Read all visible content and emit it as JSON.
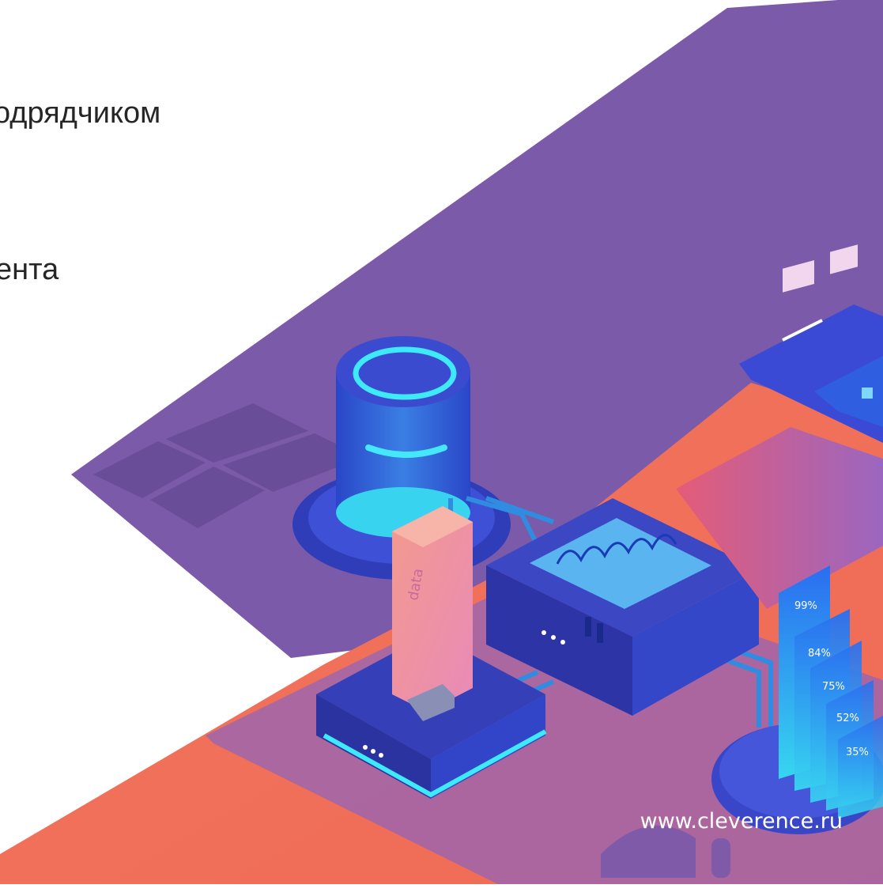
{
  "slide": {
    "lines": [
      "одрядчиком",
      "ента"
    ],
    "footer_url": "www.cleverence.ru"
  },
  "illustration": {
    "description_icons": [
      "windows-logo-icon",
      "android-logo-icon",
      "qr-code-icon",
      "usb-stick-icon",
      "database-cylinder-icon",
      "signal-box-icon",
      "mobile-phone-icon"
    ],
    "usb_label": "data",
    "bar_labels": [
      "99%",
      "84%",
      "75%",
      "52%",
      "35%"
    ],
    "colors": {
      "purple_plane": "#7a5aa9",
      "coral_plane": "#f07160",
      "blue_device": "#3443c9",
      "cyan_glow": "#33e0f6",
      "text_dark": "#262626"
    }
  }
}
